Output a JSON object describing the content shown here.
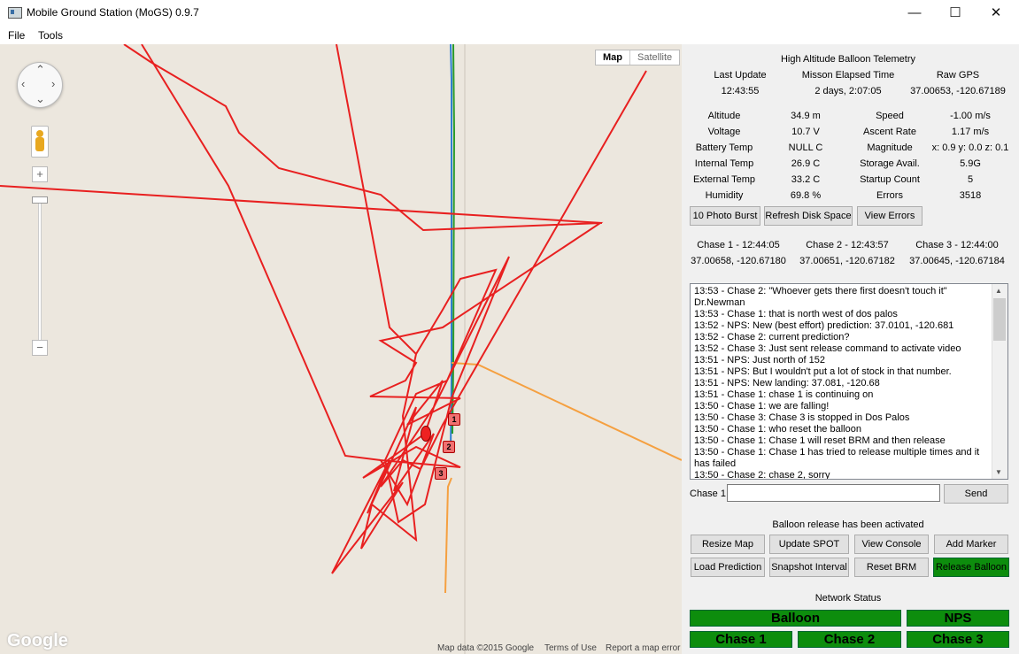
{
  "window": {
    "title": "Mobile Ground Station (MoGS) 0.9.7",
    "minimize": "—",
    "maximize": "☐",
    "close": "✕"
  },
  "menu": {
    "file": "File",
    "tools": "Tools"
  },
  "map": {
    "type_map": "Map",
    "type_satellite": "Satellite",
    "logo": "Google",
    "attribution": "Map data ©2015 Google",
    "terms": "Terms of Use",
    "report": "Report a map error",
    "zoom_in": "+",
    "zoom_out": "−",
    "markers": [
      "1",
      "2",
      "3"
    ],
    "colors": {
      "balloon_track": "#e82020",
      "prediction": "#f5a040",
      "chase_blue": "#2d7fd0",
      "chase_green": "#2a9a2a"
    }
  },
  "telemetry": {
    "header": "High Altitude Balloon Telemetry",
    "last_update_label": "Last Update",
    "last_update": "12:43:55",
    "elapsed_label": "Misson Elapsed Time",
    "elapsed": "2 days, 2:07:05",
    "gps_label": "Raw GPS",
    "gps": "37.00653, -120.67189",
    "fields": [
      {
        "l1": "Altitude",
        "v1": "34.9 m",
        "l2": "Speed",
        "v2": "-1.00 m/s"
      },
      {
        "l1": "Voltage",
        "v1": "10.7 V",
        "l2": "Ascent Rate",
        "v2": "1.17 m/s"
      },
      {
        "l1": "Battery Temp",
        "v1": "NULL C",
        "l2": "Magnitude",
        "v2": "x: 0.9 y: 0.0 z: 0.1"
      },
      {
        "l1": "Internal Temp",
        "v1": "26.9 C",
        "l2": "Storage Avail.",
        "v2": "5.9G"
      },
      {
        "l1": "External Temp",
        "v1": "33.2 C",
        "l2": "Startup Count",
        "v2": "5"
      },
      {
        "l1": "Humidity",
        "v1": "69.8 %",
        "l2": "Errors",
        "v2": "3518"
      }
    ],
    "buttons": {
      "burst": "10 Photo Burst",
      "refresh": "Refresh Disk Space",
      "errors": "View Errors"
    }
  },
  "chase": [
    {
      "title": "Chase 1 - 12:44:05",
      "coords": "37.00658, -120.67180"
    },
    {
      "title": "Chase 2 - 12:43:57",
      "coords": "37.00651, -120.67182"
    },
    {
      "title": "Chase 3 - 12:44:00",
      "coords": "37.00645, -120.67184"
    }
  ],
  "console": [
    "13:53 - Chase 2: \"Whoever gets there first doesn't touch it\" Dr.Newman",
    "13:53 - Chase 1: that is north west of dos palos",
    "13:52 - NPS: New (best effort) prediction: 37.0101, -120.681",
    "13:52 - Chase 2: current prediction?",
    "13:52 - Chase 3: Just sent release command to activate video",
    "13:51 - NPS: Just north of 152",
    "13:51 - NPS: But I wouldn't put a lot of stock in that number.",
    "13:51 - NPS: New landing: 37.081, -120.68",
    "13:51 - Chase 1: chase 1 is continuing on",
    "13:50 - Chase 1: we are falling!",
    "13:50 - Chase 3: Chase 3 is stopped in Dos Palos",
    "13:50 - Chase 1: who reset the balloon",
    "13:50 - Chase 1: Chase 1 will reset BRM and then release",
    "13:50 - Chase 1: Chase 1 has tried to release multiple times and it has failed",
    "13:50 - Chase 2: chase 2, sorry"
  ],
  "chat": {
    "label": "Chase 1",
    "value": "",
    "send": "Send"
  },
  "status_message": "Balloon release has been activated",
  "controls": [
    "Resize Map",
    "Update SPOT",
    "View Console",
    "Add Marker",
    "Load Prediction",
    "Snapshot Interval",
    "Reset BRM",
    "Release Balloon"
  ],
  "network": {
    "title": "Network Status",
    "nodes": [
      "Balloon",
      "NPS",
      "Chase 1",
      "Chase 2",
      "Chase 3"
    ],
    "ok_color": "#0d8d0d"
  }
}
